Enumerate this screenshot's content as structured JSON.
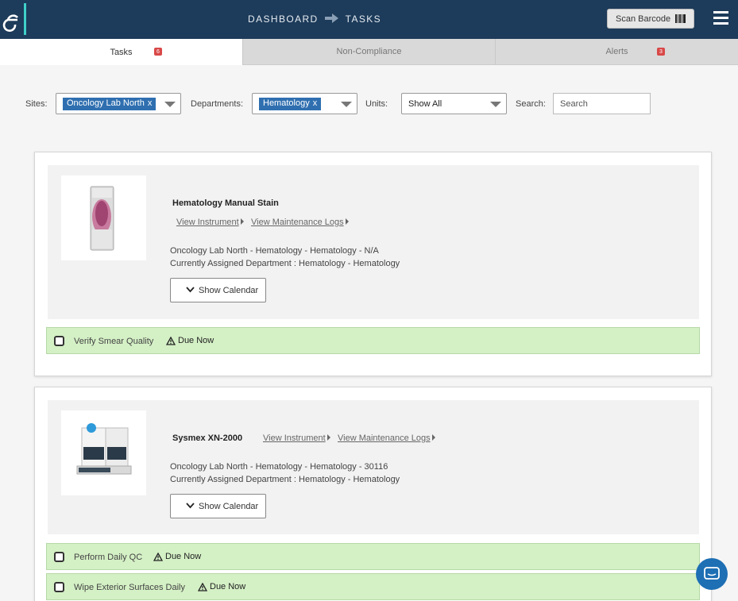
{
  "header": {
    "breadcrumb": [
      "DASHBOARD",
      "TASKS"
    ],
    "scan_label": "Scan Barcode"
  },
  "tabs": [
    {
      "label": "Tasks",
      "badge": "6"
    },
    {
      "label": "Non-Compliance",
      "badge": ""
    },
    {
      "label": "Alerts",
      "badge": "3"
    }
  ],
  "filters": {
    "sites_label": "Sites:",
    "sites_value": "Oncology Lab North",
    "departments_label": "Departments:",
    "departments_value": "Hematology",
    "chip_remove": "x",
    "units_label": "Units:",
    "units_value": "Show All",
    "search_label": "Search:",
    "search_placeholder": "Search"
  },
  "instruments": [
    {
      "name": "Hematology Manual Stain",
      "view_instrument": "View Instrument",
      "view_logs": "View Maintenance Logs",
      "location": "Oncology Lab North - Hematology - Hematology - N/A",
      "assigned": "Currently Assigned Department : Hematology - Hematology",
      "calendar_label": "Show Calendar",
      "tasks": [
        {
          "name": "Verify Smear Quality",
          "status": "Due Now"
        }
      ]
    },
    {
      "name": "Sysmex XN-2000",
      "view_instrument": "View Instrument",
      "view_logs": "View Maintenance Logs",
      "location": "Oncology Lab North - Hematology - Hematology - 30116",
      "assigned": "Currently Assigned Department : Hematology - Hematology",
      "calendar_label": "Show Calendar",
      "tasks": [
        {
          "name": "Perform Daily QC",
          "status": "Due Now"
        },
        {
          "name": "Wipe Exterior Surfaces Daily",
          "status": "Due Now"
        }
      ]
    }
  ],
  "colors": {
    "header_bg": "#1d3b5a",
    "chip_bg": "#2f6fb0",
    "task_bg": "#d4f0c5",
    "badge": "#d94848",
    "chat": "#1e6fb4"
  }
}
